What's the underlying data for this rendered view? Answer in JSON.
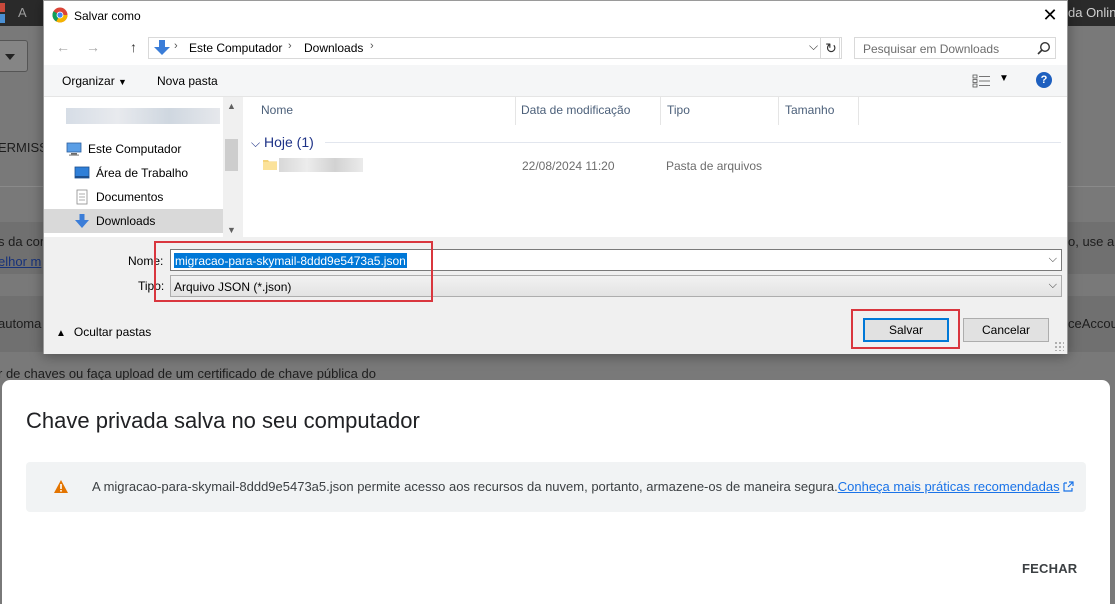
{
  "background": {
    "topbar_left_text": "A",
    "topbar_right_text": "da Online",
    "section_text": "ERMISS",
    "line1_left": "s da com",
    "line1_right": "o, use a",
    "line2_link": "elhor m",
    "line3_left": "automa",
    "line3_right": "ceAccou",
    "line4_text": "r de chaves ou faça upload de um certificado de chave pública do"
  },
  "card": {
    "title": "Chave privada salva no seu computador",
    "info_text": "A migracao-para-skymail-8ddd9e5473a5.json permite acesso aos recursos da nuvem, portanto, armazene-os de maneira segura.",
    "info_link": "Conheça mais práticas recomendadas",
    "close_label": "FECHAR",
    "warning_color": "#e37400",
    "link_color": "#1a73e8"
  },
  "dialog": {
    "title": "Salvar como",
    "close_glyph": "✕",
    "nav": {
      "back": "←",
      "forward": "→",
      "up": "↑",
      "refresh": "↻",
      "dropdown": "⌵"
    },
    "address": {
      "crumb1": "Este Computador",
      "crumb2": "Downloads",
      "sep": "›"
    },
    "search_placeholder": "Pesquisar em Downloads",
    "toolbar": {
      "organize": "Organizar",
      "new_folder": "Nova pasta",
      "help": "?"
    },
    "sidebar": [
      {
        "label": "Este Computador",
        "icon": "computer-icon"
      },
      {
        "label": "Área de Trabalho",
        "icon": "desktop-icon"
      },
      {
        "label": "Documentos",
        "icon": "documents-icon"
      },
      {
        "label": "Downloads",
        "icon": "downloads-icon",
        "selected": true
      }
    ],
    "columns": [
      "Nome",
      "Data de modificação",
      "Tipo",
      "Tamanho"
    ],
    "group": {
      "label": "Hoje (1)",
      "chevron": "⌵"
    },
    "rows": [
      {
        "date": "22/08/2024 11:20",
        "type": "Pasta de arquivos",
        "size": ""
      }
    ],
    "form": {
      "name_label": "Nome:",
      "name_value": "migracao-para-skymail-8ddd9e5473a5.json",
      "type_label": "Tipo:",
      "type_value": "Arquivo JSON (*.json)",
      "hide_folders": "Ocultar pastas",
      "save": "Salvar",
      "cancel": "Cancelar"
    },
    "accent_color": "#0078d7",
    "highlight_color": "#d9363e"
  }
}
